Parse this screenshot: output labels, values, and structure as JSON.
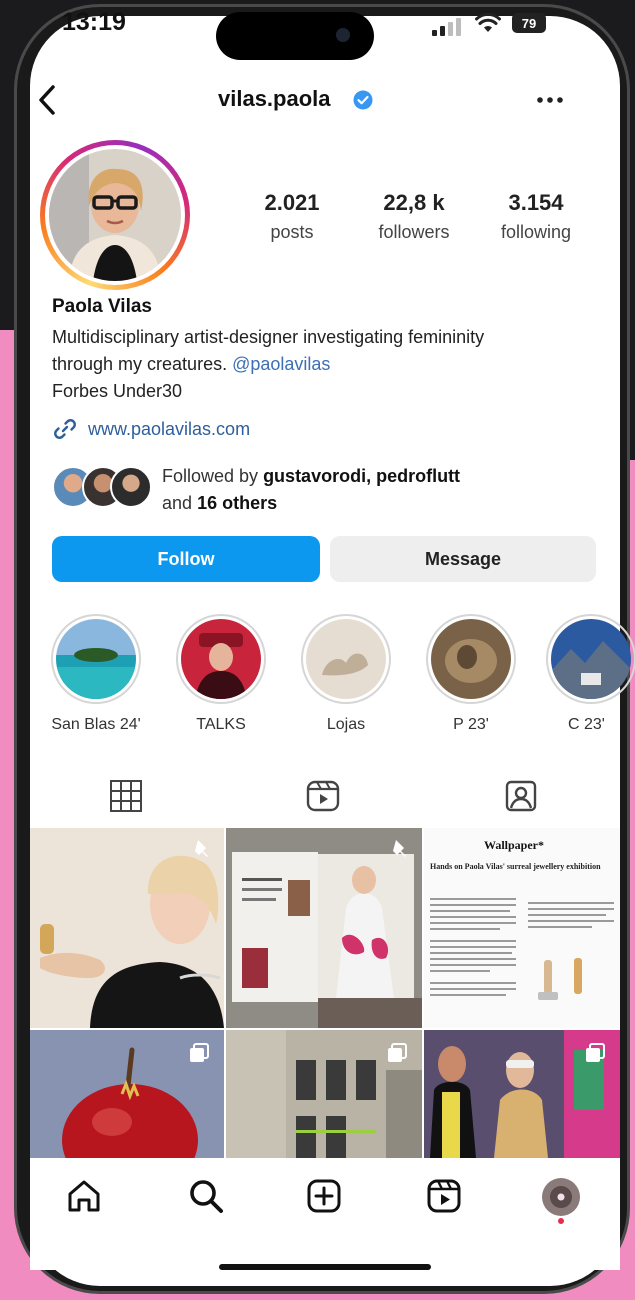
{
  "status_bar": {
    "time": "13:19",
    "battery": "79"
  },
  "header": {
    "username": "vilas.paola"
  },
  "profile": {
    "stats": [
      {
        "value": "2.021",
        "label": "posts"
      },
      {
        "value": "22,8 k",
        "label": "followers"
      },
      {
        "value": "3.154",
        "label": "following"
      }
    ],
    "name": "Paola Vilas",
    "bio_line1": "Multidisciplinary artist-designer investigating femininity",
    "bio_line2_prefix": "through my creatures.",
    "bio_mention": "@paolavilas",
    "bio_line3": "Forbes Under30",
    "website": "www.paolavilas.com",
    "followed_by_prefix": "Followed by",
    "followed_by_users": "gustavorodi, pedroflutt",
    "followed_by_and": "and",
    "followed_by_others": "16 others"
  },
  "actions": {
    "follow": "Follow",
    "message": "Message"
  },
  "highlights": [
    {
      "label": "San Blas 24'"
    },
    {
      "label": "TALKS"
    },
    {
      "label": "Lojas"
    },
    {
      "label": "P 23'"
    },
    {
      "label": "C 23'"
    }
  ],
  "tabs": [
    "grid-icon",
    "reels-icon",
    "tagged-icon"
  ],
  "grid_posts": {
    "post3_masthead": "Wallpaper*",
    "post3_headline": "Hands on Paola Vilas' surreal jewellery exhibition"
  },
  "nav": [
    "home-icon",
    "search-icon",
    "create-icon",
    "reels-icon",
    "profile-avatar"
  ],
  "colors": {
    "follow_button": "#0d98ef",
    "link": "#2f5e9c",
    "background": "#f08cbf"
  }
}
